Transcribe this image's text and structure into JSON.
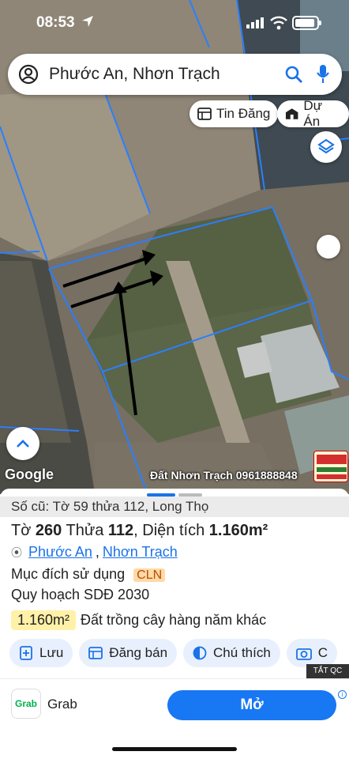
{
  "status": {
    "time": "08:53"
  },
  "search": {
    "query": "Phước An, Nhơn Trạch"
  },
  "chips": {
    "listing": "Tin Đăng",
    "project": "Dự Án"
  },
  "map": {
    "google_label": "Google",
    "watermark": "Đất Nhơn Trạch 0961888848"
  },
  "sheet": {
    "old_parcel": "Số cũ: Tờ 59 thửa 112, Long Thọ",
    "sheet_label": "Tờ",
    "sheet_no": "260",
    "parcel_label": "Thửa",
    "parcel_no": "112",
    "area_label": "Diện tích",
    "area": "1.160m²",
    "ward": "Phước An",
    "district": "Nhơn Trạch",
    "purpose_label": "Mục đích sử dụng",
    "purpose_code": "CLN",
    "planning": "Quy hoạch SDĐ 2030",
    "area_value": "1.160m²",
    "land_type": "Đất trồng cây hàng năm khác"
  },
  "actions": {
    "save": "Lưu",
    "post": "Đăng bán",
    "note": "Chú thích",
    "more": "C"
  },
  "ad": {
    "close_label": "TẮT QC",
    "logo_text": "Grab",
    "name": "Grab",
    "cta": "Mở"
  },
  "colors": {
    "accent": "#1a73e8",
    "boundary": "#2a7fff",
    "cta": "#1877f2"
  }
}
